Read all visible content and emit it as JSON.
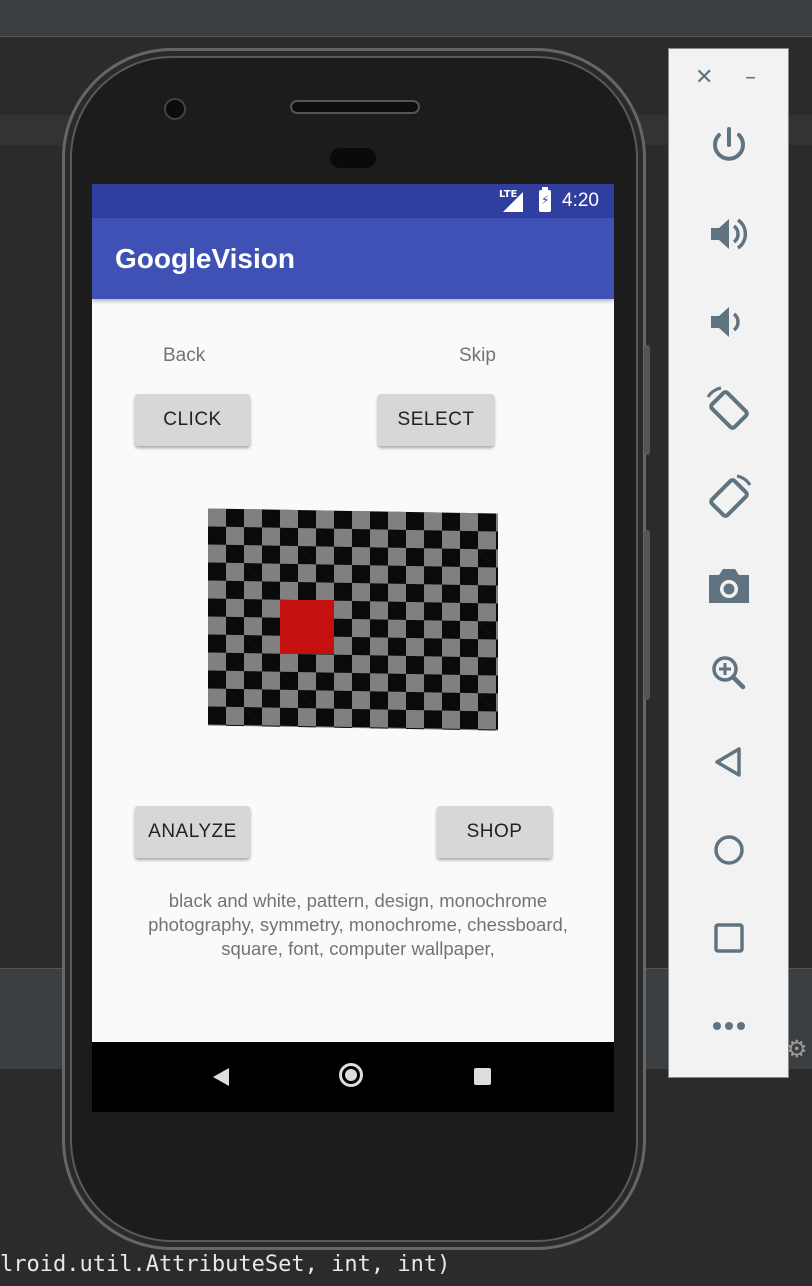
{
  "app": {
    "title": "GoogleVision",
    "status_bar": {
      "network": "LTE",
      "time": "4:20"
    },
    "links": {
      "back": "Back",
      "skip": "Skip"
    },
    "buttons": {
      "click": "CLICK",
      "select": "SELECT",
      "analyze": "ANALYZE",
      "shop": "SHOP"
    },
    "labels_text": "black and white,   pattern,   design,   monochrome photography,   symmetry,   monochrome,   chessboard,   square,   font,   computer wallpaper,"
  },
  "ide": {
    "code_line": "lroid.util.AttributeSet, int, int)"
  },
  "toolbar": {
    "close": "✕",
    "minimize": "–",
    "items": [
      "power-icon",
      "volume-up-icon",
      "volume-down-icon",
      "rotate-left-icon",
      "rotate-right-icon",
      "camera-icon",
      "zoom-icon",
      "back-icon",
      "home-icon",
      "overview-icon",
      "more-icon"
    ]
  },
  "colors": {
    "status_bar": "#303f9f",
    "app_bar": "#3f51b5",
    "accent_red": "#c4100f",
    "toolbar_icon": "#5f7480"
  }
}
